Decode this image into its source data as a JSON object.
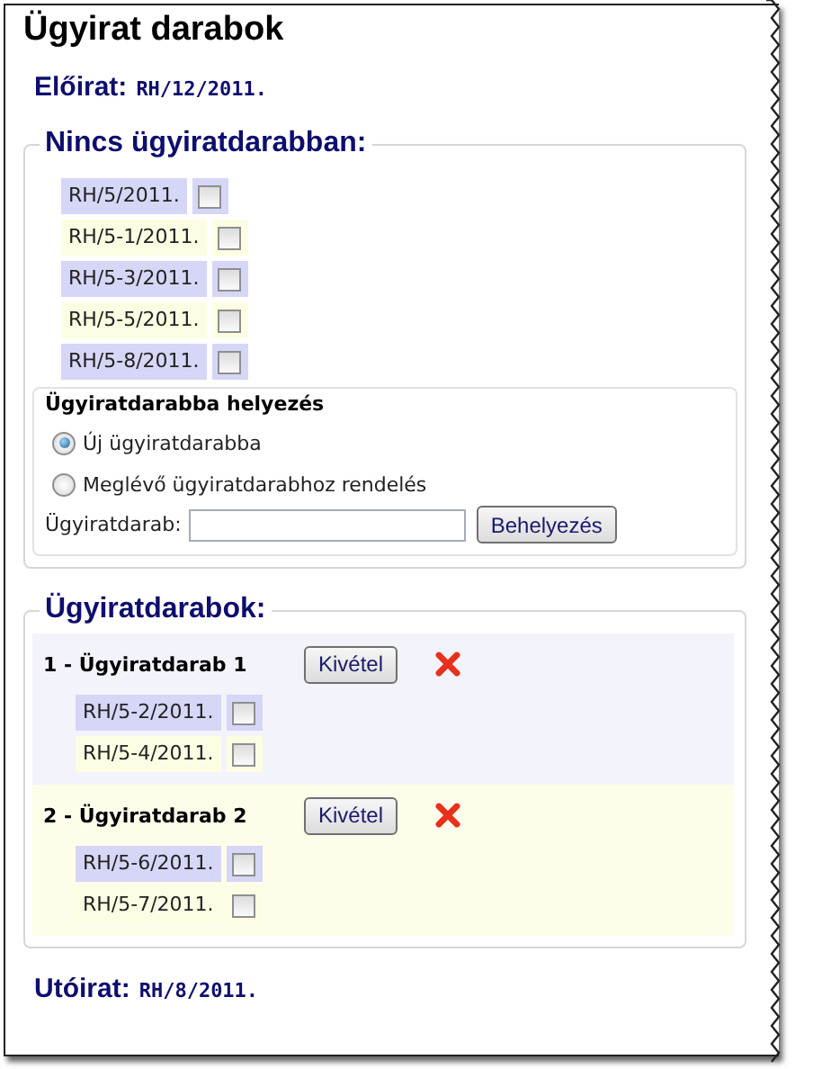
{
  "title": "Ügyirat darabok",
  "previous": {
    "label": "Előirat:",
    "value": "RH/12/2011."
  },
  "unassigned": {
    "legend": "Nincs ügyiratdarabban:",
    "items": [
      {
        "label": "RH/5/2011.",
        "checked": false
      },
      {
        "label": "RH/5-1/2011.",
        "checked": false
      },
      {
        "label": "RH/5-3/2011.",
        "checked": false
      },
      {
        "label": "RH/5-5/2011.",
        "checked": false
      },
      {
        "label": "RH/5-8/2011.",
        "checked": false
      }
    ],
    "placement": {
      "title": "Ügyiratdarabba helyezés",
      "options": [
        {
          "label": "Új ügyiratdarabba",
          "selected": true
        },
        {
          "label": "Meglévő ügyiratdarabhoz rendelés",
          "selected": false
        }
      ],
      "field": {
        "label": "Ügyiratdarab:"
      },
      "button": "Behelyezés"
    }
  },
  "pieces": {
    "legend": "Ügyiratdarabok:",
    "groups": [
      {
        "title": "1 - Ügyiratdarab 1",
        "button": "Kivétel",
        "items": [
          {
            "label": "RH/5-2/2011.",
            "checked": false
          },
          {
            "label": "RH/5-4/2011.",
            "checked": false
          }
        ]
      },
      {
        "title": "2 - Ügyiratdarab 2",
        "button": "Kivétel",
        "items": [
          {
            "label": "RH/5-6/2011.",
            "checked": false
          },
          {
            "label": "RH/5-7/2011.",
            "checked": false
          }
        ]
      }
    ]
  },
  "next": {
    "label": "Utóirat:",
    "value": "RH/8/2011."
  }
}
